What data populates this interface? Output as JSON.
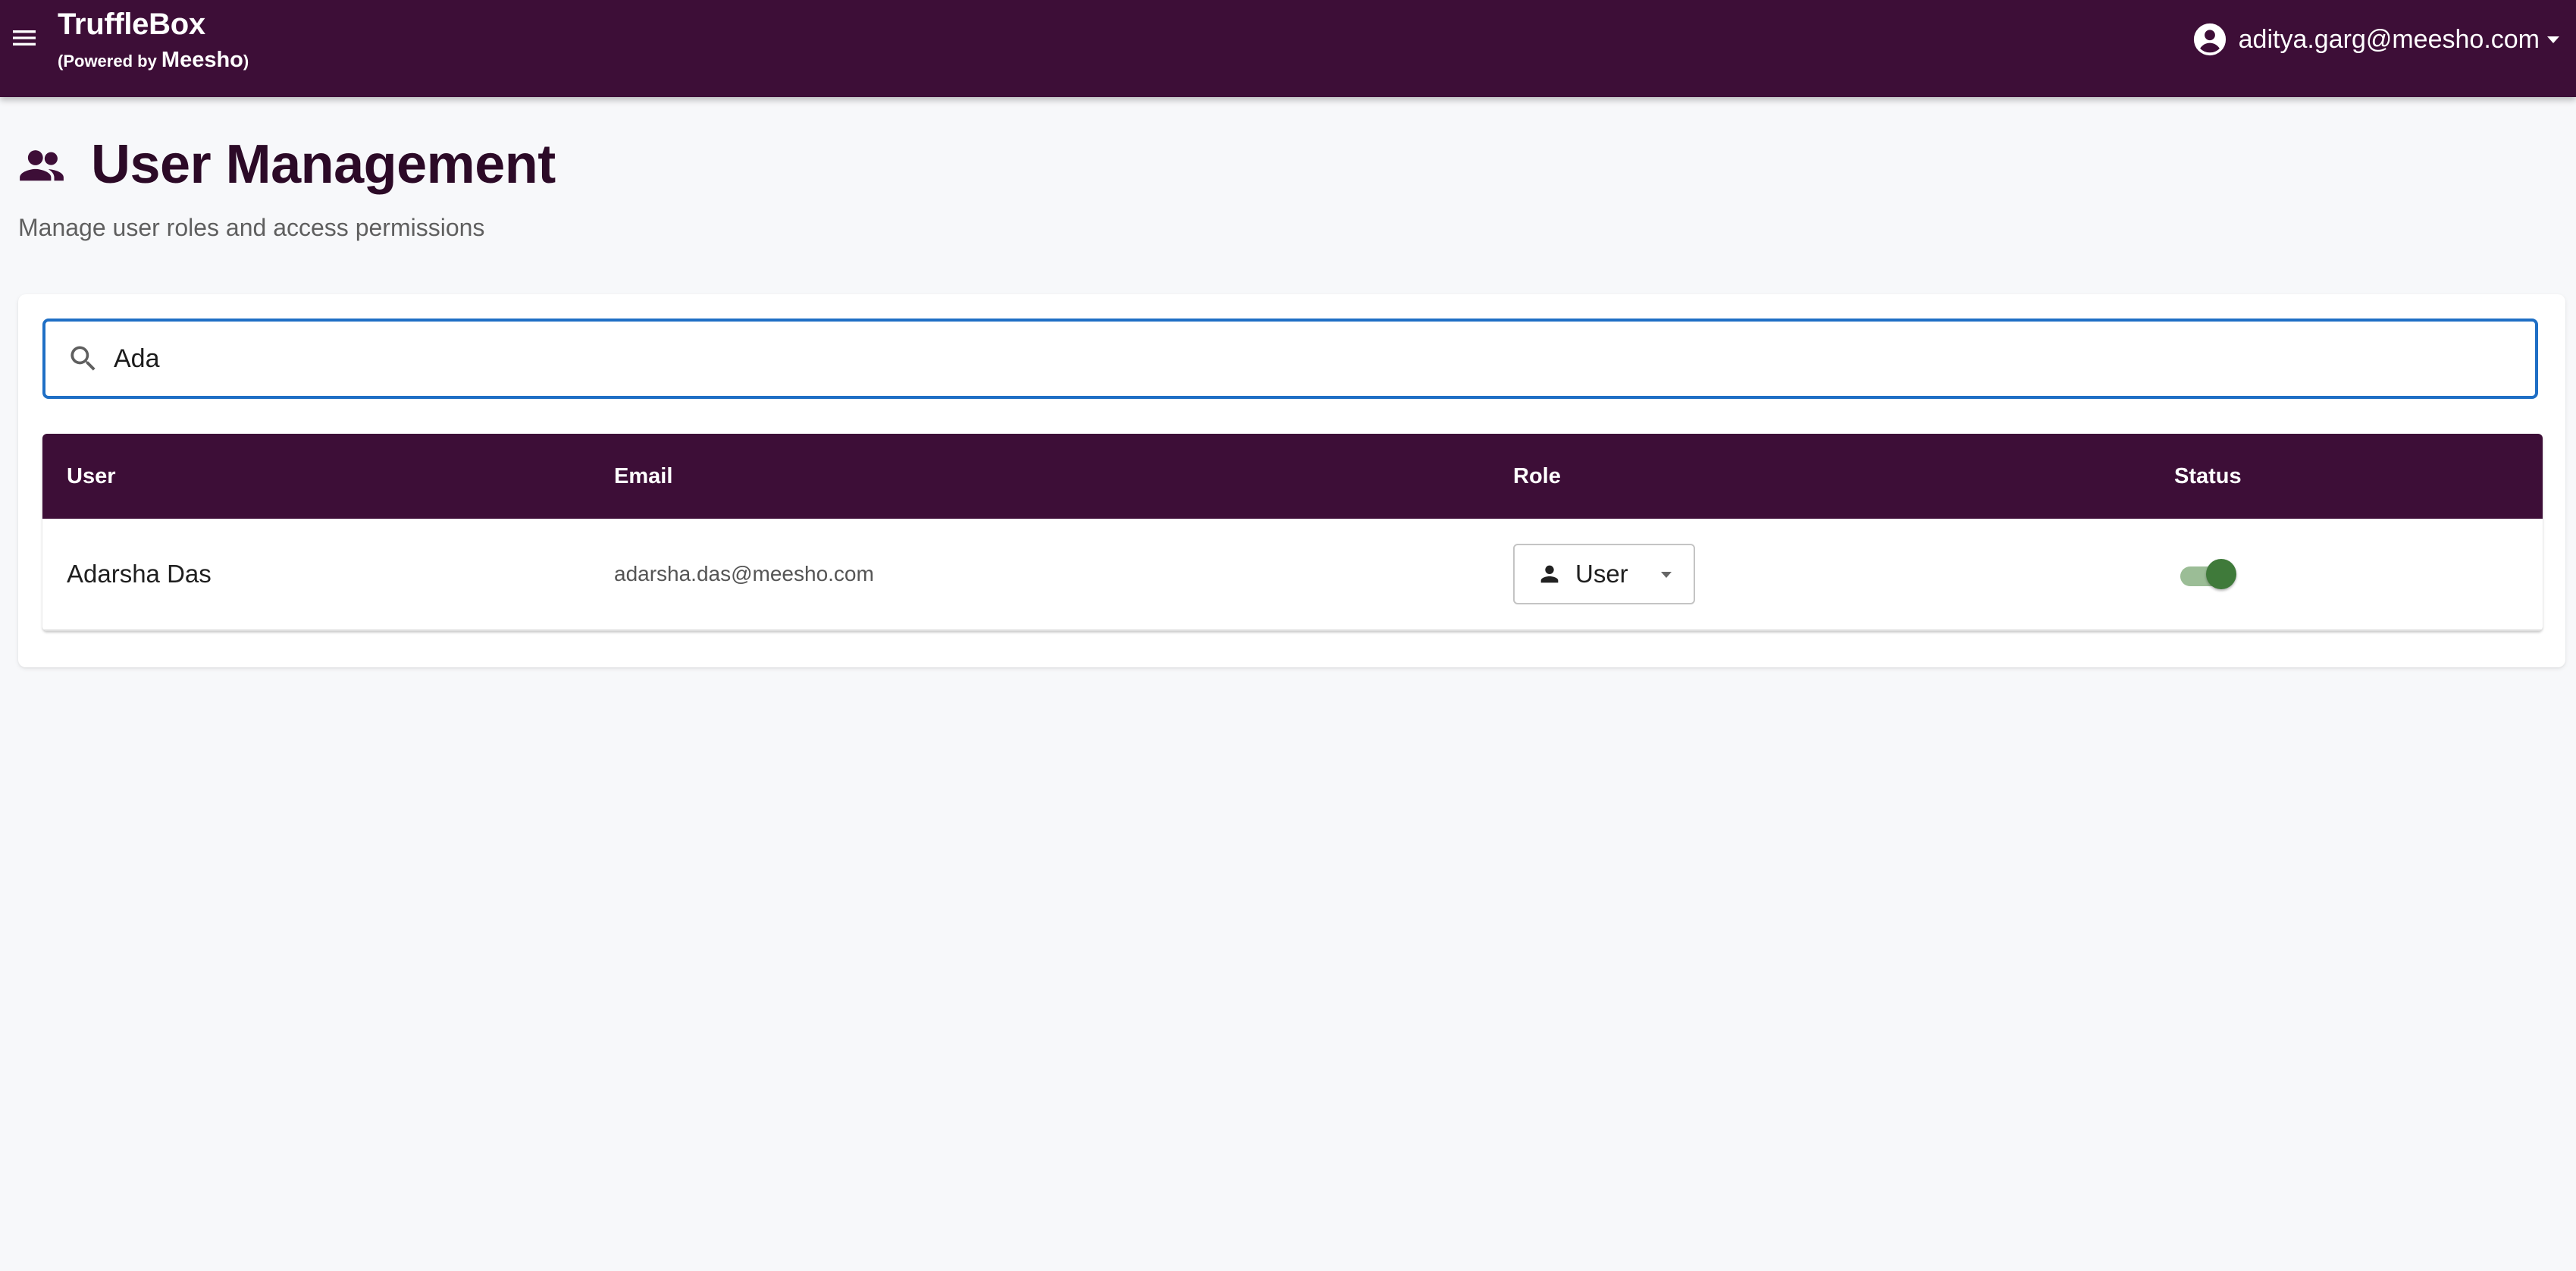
{
  "app": {
    "title": "TruffleBox",
    "powered_prefix": "(Powered by ",
    "powered_brand": "Meesho",
    "powered_suffix": ")",
    "menu_icon": "hamburger-menu-icon",
    "brand_color": "#3d0e37"
  },
  "user_menu": {
    "email": "aditya.garg@meesho.com",
    "icon": "account-circle-icon"
  },
  "page": {
    "icon": "people-icon",
    "title": "User Management",
    "subtitle": "Manage user roles and access permissions"
  },
  "search": {
    "value": "Ada",
    "icon": "search-icon",
    "focus_color": "#1f6fc5"
  },
  "table": {
    "columns": [
      "User",
      "Email",
      "Role",
      "Status"
    ],
    "rows": [
      {
        "user": "Adarsha Das",
        "email": "adarsha.das@meesho.com",
        "role": "User",
        "role_icon": "person-icon",
        "status_active": true
      }
    ]
  },
  "colors": {
    "toggle_on_thumb": "#3f7a3a",
    "toggle_on_track": "#9bbd96"
  }
}
